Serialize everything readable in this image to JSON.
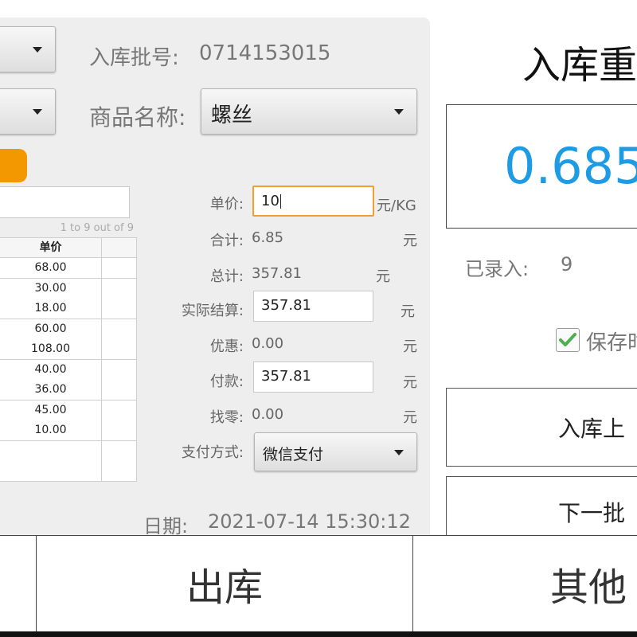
{
  "header": {
    "batch_label": "入库批号:",
    "batch_value": "0714153015",
    "product_label": "商品名称:",
    "product_value": "螺丝"
  },
  "table": {
    "pagination": "1 to 9 out of 9",
    "column_header": "单价",
    "prices": [
      "68.00",
      "30.00",
      "18.00",
      "60.00",
      "108.00",
      "40.00",
      "36.00",
      "45.00",
      "10.00",
      "",
      ""
    ]
  },
  "form": {
    "unit_price_label": "单价:",
    "unit_price_value": "10",
    "unit_price_unit": "元/KG",
    "subtotal_label": "合计:",
    "subtotal_value": "6.85",
    "total_label": "总计:",
    "total_value": "357.81",
    "actual_label": "实际结算:",
    "actual_value": "357.81",
    "discount_label": "优惠:",
    "discount_value": "0.00",
    "payment_label": "付款:",
    "payment_value": "357.81",
    "change_label": "找零:",
    "change_value": "0.00",
    "method_label": "支付方式:",
    "method_value": "微信支付",
    "currency": "元",
    "date_label": "日期:",
    "date_value": "2021-07-14 15:30:12"
  },
  "right": {
    "title": "入库重",
    "weight": "0.685",
    "entered_label": "已录入:",
    "entered_count": "9",
    "save_label": "保存时",
    "upload_button": "入库上",
    "next_button": "下一批"
  },
  "nav": {
    "outbound": "出库",
    "other": "其他"
  },
  "colors": {
    "accent": "#1e9be5",
    "orange": "#f39800",
    "check": "#4caf50"
  }
}
